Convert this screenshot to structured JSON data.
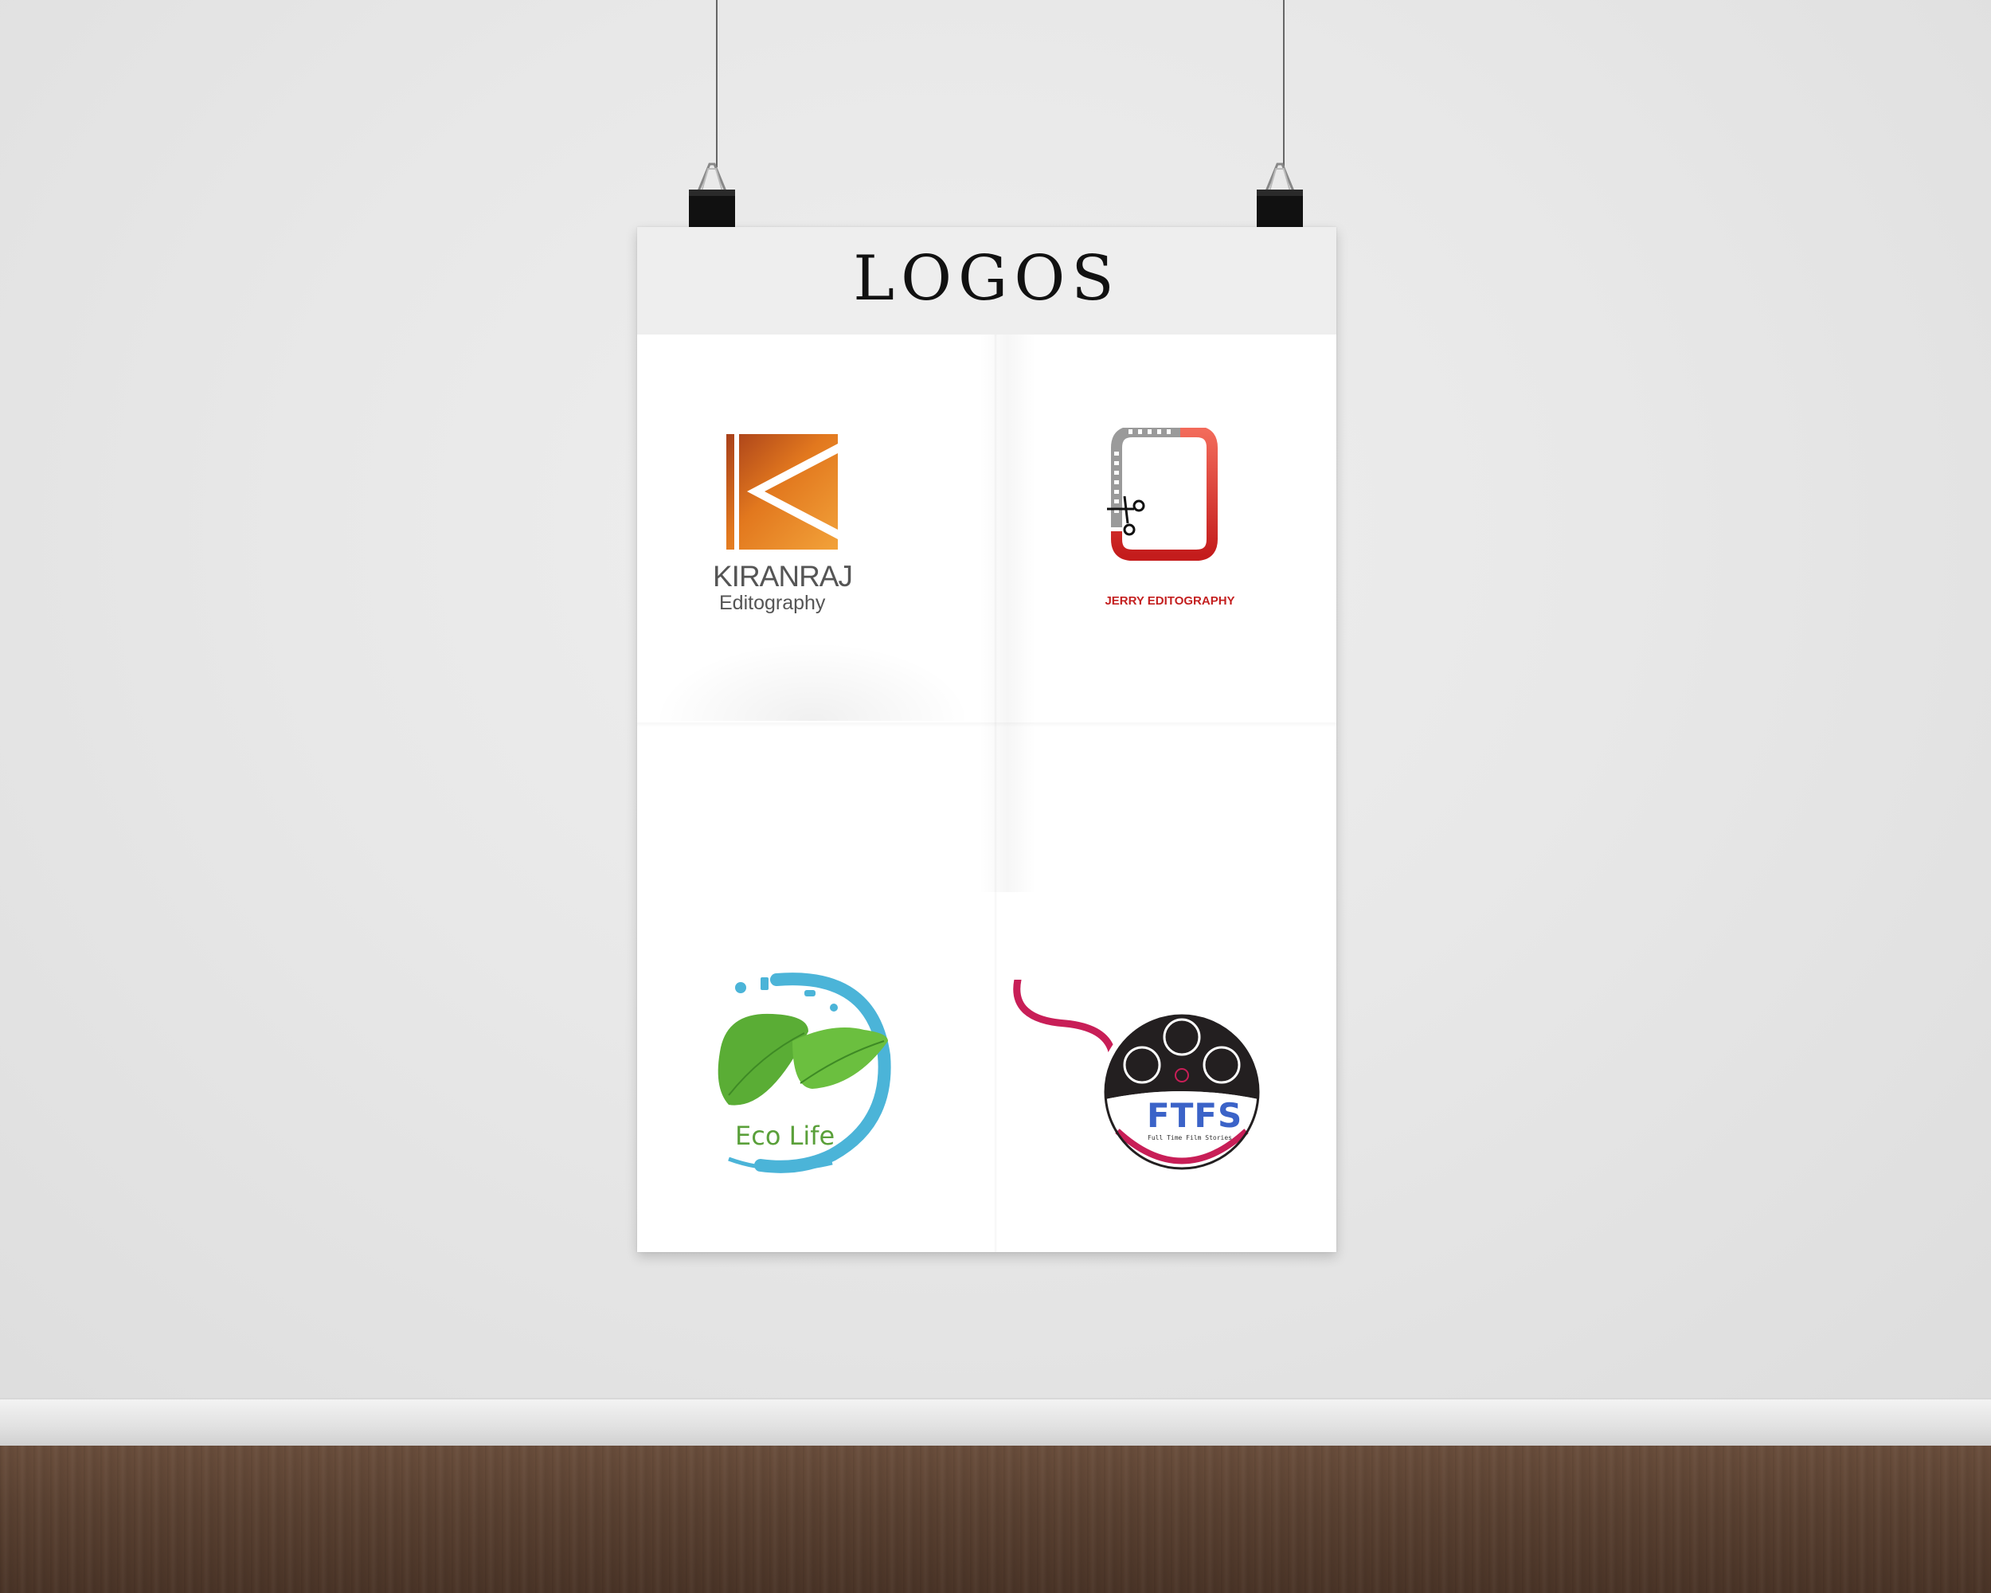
{
  "poster": {
    "title": "LOGOS"
  },
  "logos": [
    {
      "name": "kiranraj-logo",
      "line1": "KIRANRAJ",
      "line2": "Editography"
    },
    {
      "name": "jerry-logo",
      "line1": "JERRY EDITOGRAPHY"
    },
    {
      "name": "eco-life-logo",
      "line1": "Eco Life"
    },
    {
      "name": "ftfs-logo",
      "line1": "FTFS",
      "line2": "Full Time Film Stories"
    }
  ]
}
